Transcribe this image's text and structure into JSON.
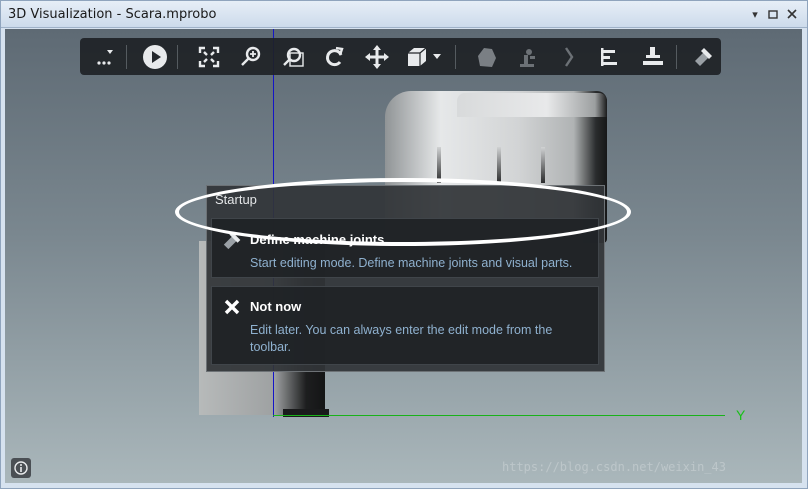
{
  "window": {
    "title": "3D Visualization - Scara.mprobo",
    "controls": [
      "dropdown-icon",
      "restore-icon",
      "close-icon"
    ]
  },
  "toolbar": {
    "buttons": [
      {
        "name": "more-menu-button",
        "icon": "ellipsis-dropdown-icon"
      },
      {
        "name": "play-button",
        "icon": "play-icon"
      },
      {
        "name": "fit-view-button",
        "icon": "fit-all-icon"
      },
      {
        "name": "zoom-button",
        "icon": "zoom-icon"
      },
      {
        "name": "zoom-window-button",
        "icon": "zoom-window-icon"
      },
      {
        "name": "rotate-button",
        "icon": "rotate-icon"
      },
      {
        "name": "pan-button",
        "icon": "move-arrows-icon"
      },
      {
        "name": "view-cube-button",
        "icon": "cube-icon"
      },
      {
        "name": "material-button",
        "icon": "shape-icon"
      },
      {
        "name": "robot-button",
        "icon": "robot-arm-icon"
      },
      {
        "name": "next-button",
        "icon": "chevron-right-icon"
      },
      {
        "name": "align-button",
        "icon": "align-icon"
      },
      {
        "name": "tool-button",
        "icon": "tool-icon"
      },
      {
        "name": "edit-mode-button",
        "icon": "wrench-icon"
      }
    ]
  },
  "scene": {
    "axis_label_y": "Y"
  },
  "startup": {
    "title": "Startup",
    "options": [
      {
        "icon": "wrench-icon",
        "title": "Define machine joints",
        "description": "Start editing mode. Define machine joints and visual parts."
      },
      {
        "icon": "close-x-icon",
        "title": "Not now",
        "description": "Edit later. You can always enter the edit mode from the toolbar."
      }
    ]
  },
  "watermark": "https://blog.csdn.net/weixin_43",
  "colors": {
    "axis_vertical": "#1414c8",
    "axis_horizontal": "#19b219",
    "accent_text": "#8fb1cf"
  }
}
